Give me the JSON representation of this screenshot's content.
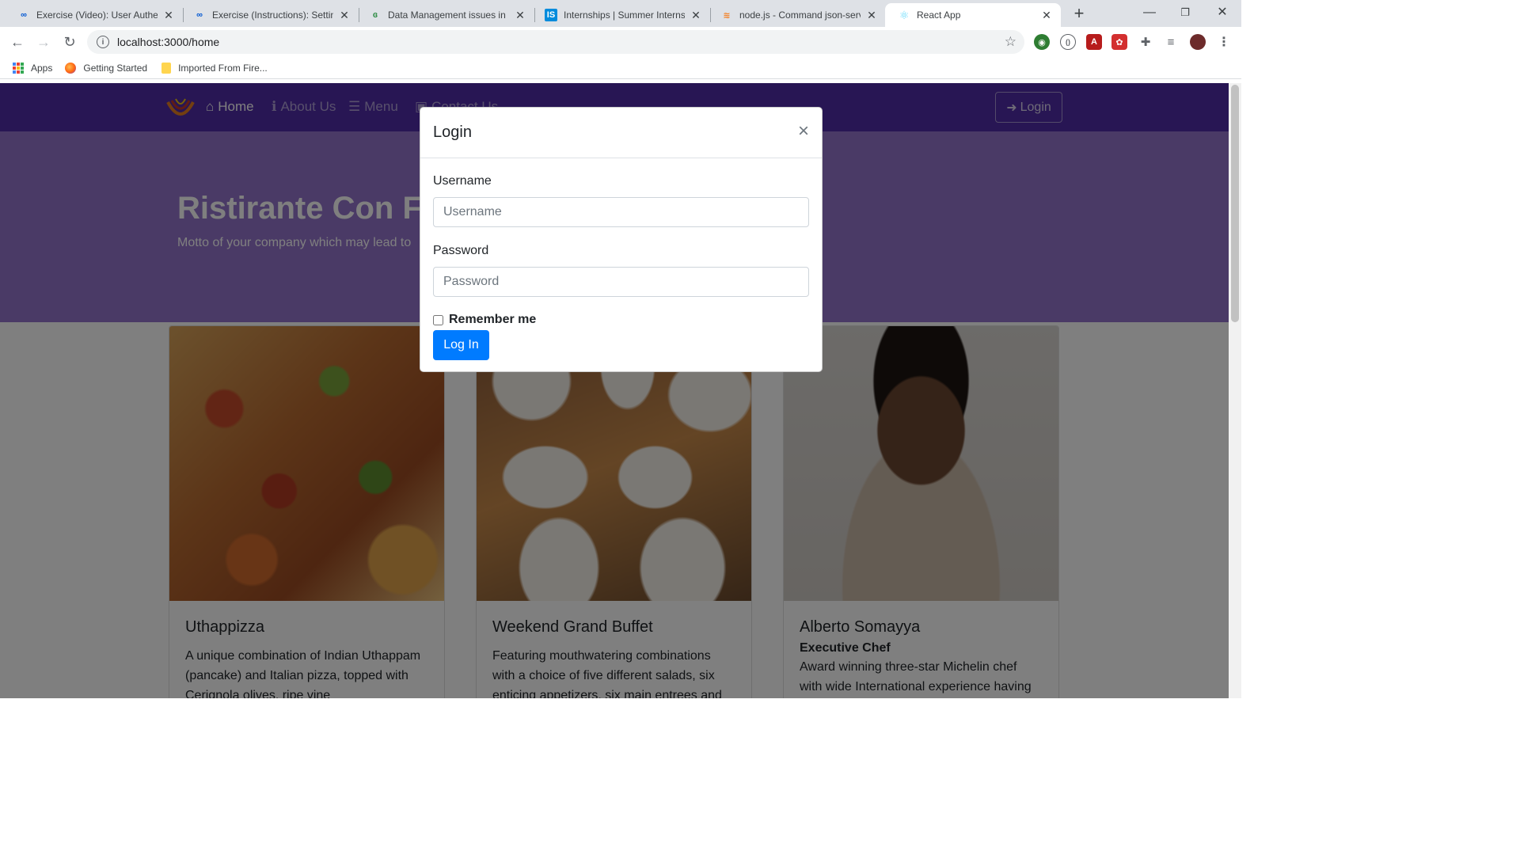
{
  "browser": {
    "tabs": [
      {
        "title": "Exercise (Video): User Authen",
        "favicon": "coursera-icon"
      },
      {
        "title": "Exercise (Instructions): Setting",
        "favicon": "coursera-icon"
      },
      {
        "title": "Data Management issues in",
        "favicon": "geeksforgeeks-icon"
      },
      {
        "title": "Internships | Summer Interns",
        "favicon": "internshala-icon"
      },
      {
        "title": "node.js - Command json-serv",
        "favicon": "stackoverflow-icon"
      },
      {
        "title": "React App",
        "favicon": "react-icon"
      }
    ],
    "url": "localhost:3000/home",
    "bookmarks": [
      {
        "label": "Apps"
      },
      {
        "label": "Getting Started"
      },
      {
        "label": "Imported From Fire..."
      }
    ]
  },
  "site": {
    "nav": {
      "home": "Home",
      "about": "About Us",
      "menu": "Menu",
      "contact": "Contact Us",
      "login": "Login"
    },
    "jumbotron": {
      "title": "Ristirante Con Fusion",
      "motto": "Motto of your company which may lead to"
    },
    "cards": [
      {
        "title": "Uthappizza",
        "subtitle": "",
        "text": "A unique combination of Indian Uthappam (pancake) and Italian pizza, topped with Cerignola olives, ripe vine"
      },
      {
        "title": "Weekend Grand Buffet",
        "subtitle": "",
        "text": "Featuring mouthwatering combinations with a choice of five different salads, six enticing appetizers, six main entrees and"
      },
      {
        "title": "Alberto Somayya",
        "subtitle": "Executive Chef",
        "text": "Award winning three-star Michelin chef with wide International experience having"
      }
    ]
  },
  "modal": {
    "title": "Login",
    "close": "×",
    "username_label": "Username",
    "username_placeholder": "Username",
    "password_label": "Password",
    "password_placeholder": "Password",
    "remember_label": "Remember me",
    "submit_label": "Log In"
  },
  "colors": {
    "navbar": "#512da8",
    "jumbotron": "#9575cd",
    "primary_button": "#007bff"
  }
}
